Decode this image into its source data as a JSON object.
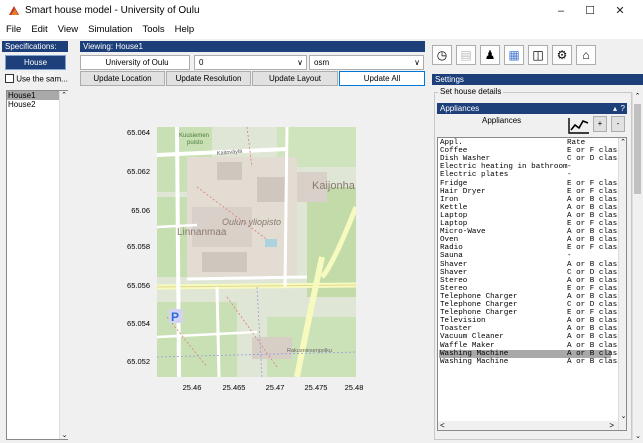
{
  "window": {
    "title": "Smart house model - University of Oulu"
  },
  "menu": [
    "File",
    "Edit",
    "View",
    "Simulation",
    "Tools",
    "Help"
  ],
  "left": {
    "specifications_label": "Specifications:",
    "house_selection_label": "House Selection?",
    "use_same_label": "Use the sam...",
    "houses": [
      "House1",
      "House2"
    ]
  },
  "center": {
    "viewing_label": "Viewing: House1",
    "location_value": "University of Oulu",
    "resolution_value": "0",
    "layout_value": "osm",
    "buttons": {
      "update_location": "Update Location",
      "update_resolution": "Update Resolution",
      "update_layout": "Update Layout",
      "update_all": "Update All"
    },
    "map": {
      "y_ticks": [
        "65.064",
        "65.062",
        "65.06",
        "65.058",
        "65.056",
        "65.054",
        "65.052"
      ],
      "x_ticks": [
        "25.46",
        "25.465",
        "25.47",
        "25.475",
        "25.48"
      ],
      "labels": {
        "kuusi": "Kuusiemen\npuisto",
        "katu": "Kaitoväylä",
        "kaijon": "Kaijonha",
        "oulu": "Oulun yliopisto",
        "linnan": "Linnanmaa",
        "road": "Rakusniesenpolku"
      }
    }
  },
  "right": {
    "settings_label": "Settings",
    "set_house_details": "Set house details",
    "appliances_header": "Appliances",
    "appliances_title": "Appliances",
    "plus": "+",
    "minus": "-",
    "table_header": {
      "name": "Appl.",
      "rate": "Rate"
    },
    "appliances": [
      [
        "Coffee",
        "E or F class"
      ],
      [
        "Dish Washer",
        "C or D class"
      ],
      [
        "Electric heating in bathroom",
        "-"
      ],
      [
        "Electric plates",
        "-"
      ],
      [
        "Fridge",
        "E or F class"
      ],
      [
        "Hair Dryer",
        "E or F class"
      ],
      [
        "Iron",
        "A or B class"
      ],
      [
        "Kettle",
        "A or B class"
      ],
      [
        "Laptop",
        "A or B class"
      ],
      [
        "Laptop",
        "E or F class"
      ],
      [
        "Micro-Wave",
        "A or B class"
      ],
      [
        "Oven",
        "A or B class"
      ],
      [
        "Radio",
        "E or F class"
      ],
      [
        "Sauna",
        "-"
      ],
      [
        "Shaver",
        "A or B class"
      ],
      [
        "Shaver",
        "C or D class"
      ],
      [
        "Stereo",
        "A or B class"
      ],
      [
        "Stereo",
        "E or F class"
      ],
      [
        "Telephone Charger",
        "A or B class"
      ],
      [
        "Telephone Charger",
        "C or D class"
      ],
      [
        "Telephone Charger",
        "E or F class"
      ],
      [
        "Television",
        "A or B class"
      ],
      [
        "Toaster",
        "A or B class"
      ],
      [
        "Vacuum Cleaner",
        "A or B class"
      ],
      [
        "Waffle Maker",
        "A or B class"
      ],
      [
        "Washing Machine",
        "A or B class"
      ],
      [
        "Washing Machine",
        "A or B class"
      ]
    ],
    "selected_index": 25
  }
}
